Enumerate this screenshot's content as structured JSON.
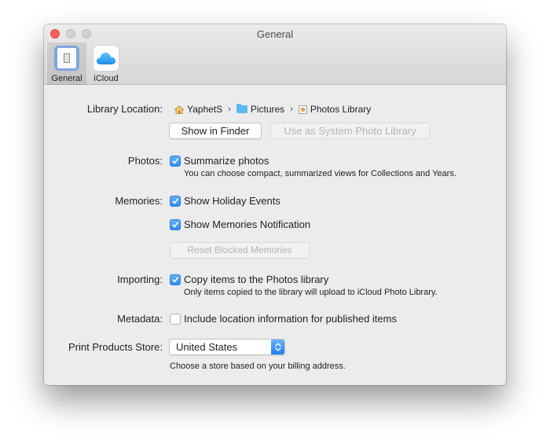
{
  "window": {
    "title": "General",
    "traffic_lights": {
      "close": "close-button",
      "minimize": "minimize-button",
      "zoom": "zoom-button"
    }
  },
  "tabs": [
    {
      "label": "General",
      "icon": "general-icon",
      "active": true
    },
    {
      "label": "iCloud",
      "icon": "icloud-icon",
      "active": false
    }
  ],
  "library_location": {
    "label": "Library Location:",
    "path": [
      {
        "name": "YaphetS",
        "icon": "home-icon"
      },
      {
        "name": "Pictures",
        "icon": "folder-icon"
      },
      {
        "name": "Photos Library",
        "icon": "photos-library-icon"
      }
    ],
    "separator": "›",
    "show_in_finder": "Show in Finder",
    "use_as_system": "Use as System Photo Library"
  },
  "photos": {
    "label": "Photos:",
    "summarize": {
      "label": "Summarize photos",
      "checked": true
    },
    "note": "You can choose compact, summarized views for Collections and Years."
  },
  "memories": {
    "label": "Memories:",
    "holiday": {
      "label": "Show Holiday Events",
      "checked": true
    },
    "notification": {
      "label": "Show Memories Notification",
      "checked": true
    },
    "reset_button": "Reset Blocked Memories"
  },
  "importing": {
    "label": "Importing:",
    "copy": {
      "label": "Copy items to the Photos library",
      "checked": true
    },
    "note": "Only items copied to the library will upload to iCloud Photo Library."
  },
  "metadata": {
    "label": "Metadata:",
    "location": {
      "label": "Include location information for published items",
      "checked": false
    }
  },
  "print_store": {
    "label": "Print Products Store:",
    "selected": "United States",
    "note": "Choose a store based on your billing address."
  },
  "colors": {
    "accent": "#2d8cf0",
    "close": "#fc5f57",
    "window_bg": "#ececec"
  }
}
